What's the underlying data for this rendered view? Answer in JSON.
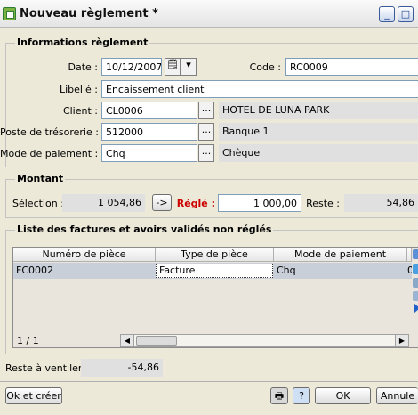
{
  "window": {
    "title": "Nouveau règlement *",
    "minimize": "_",
    "maximize": "□"
  },
  "info": {
    "title": "Informations règlement",
    "date_label": "Date :",
    "date_value": "10/12/2007",
    "code_label": "Code :",
    "code_value": "RC0009",
    "libelle_label": "Libellé :",
    "libelle_value": "Encaissement client",
    "client_label": "Client :",
    "client_code": "CL0006",
    "client_name": "HOTEL DE LUNA PARK",
    "poste_label": "Poste de trésorerie :",
    "poste_code": "512000",
    "poste_name": "Banque 1",
    "mode_label": "Mode de paiement :",
    "mode_code": "Chq",
    "mode_name": "Chèque",
    "browse": "..."
  },
  "montant": {
    "title": "Montant",
    "selection_label": "Sélection :",
    "selection_value": "1 054,86",
    "transfer": "->",
    "regle_label": "Réglé :",
    "regle_value": "1 000,00",
    "reste_label": "Reste :",
    "reste_value": "54,86"
  },
  "factures": {
    "title": "Liste des factures et avoirs validés non réglés",
    "columns": [
      "Numéro de pièce",
      "Type de pièce",
      "Mode de paiement"
    ],
    "rows": [
      {
        "numero": "FC0002",
        "type": "Facture",
        "mode": "Chq",
        "extra": "0"
      }
    ],
    "pager": "1 / 1"
  },
  "reste_ventiler": {
    "label": "Reste à ventiler :",
    "value": "-54,86"
  },
  "footer": {
    "ok_create": "Ok et créer",
    "ok": "OK",
    "cancel": "Annule"
  },
  "colors": {
    "accent_red": "#cc0000",
    "readonly_gray": "#e0e0e0",
    "window_bg": "#ece9d8"
  }
}
